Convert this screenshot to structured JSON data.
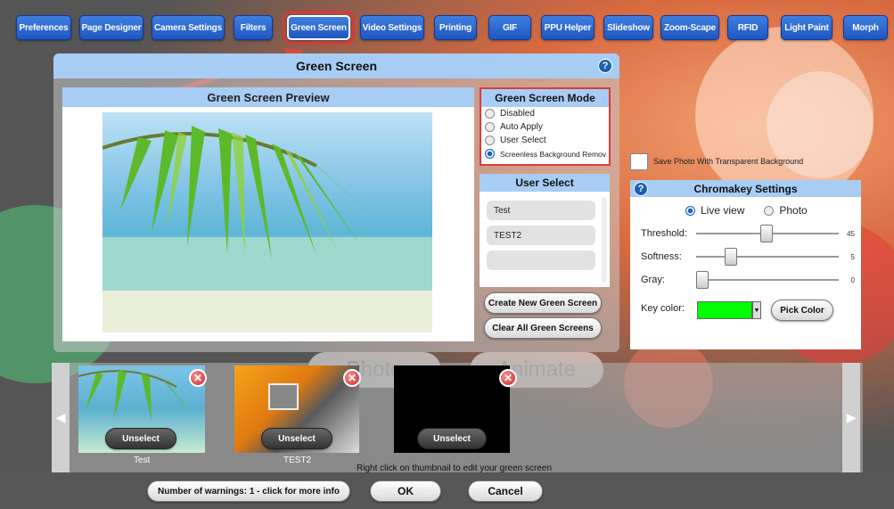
{
  "tabs": [
    "Preferences",
    "Page Designer",
    "Camera Settings",
    "Filters",
    "Green Screen",
    "Video Settings",
    "Printing",
    "GIF",
    "PPU Helper",
    "Slideshow",
    "Zoom-Scape",
    "RFID",
    "Light Paint",
    "Morph"
  ],
  "panel": {
    "title": "Green Screen",
    "help": "?"
  },
  "preview": {
    "title": "Green Screen Preview"
  },
  "mode": {
    "title": "Green Screen Mode",
    "options": [
      "Disabled",
      "Auto Apply",
      "User Select",
      "Screenless Background Remov"
    ],
    "selected": "Screenless Background Remov"
  },
  "user_select": {
    "title": "User Select",
    "items": [
      "Test",
      "TEST2",
      ""
    ]
  },
  "buttons": {
    "create": "Create New Green Screen",
    "clear": "Clear All Green Screens",
    "pick_color": "Pick Color",
    "warnings": "Number of warnings: 1 - click for more info",
    "ok": "OK",
    "cancel": "Cancel"
  },
  "save_transparent": "Save Photo With Transparent Background",
  "chroma": {
    "title": "Chromakey Settings",
    "live_view": "Live view",
    "photo": "Photo",
    "threshold_label": "Threshold:",
    "threshold_value": "45",
    "softness_label": "Softness:",
    "softness_value": "5",
    "gray_label": "Gray:",
    "gray_value": "0",
    "key_color_label": "Key color:",
    "key_color": "#00ff00"
  },
  "ghost": {
    "photo": "Photo",
    "animate": "Animate"
  },
  "thumbs": [
    {
      "label": "Test",
      "unselect": "Unselect"
    },
    {
      "label": "TEST2",
      "unselect": "Unselect"
    },
    {
      "label": "",
      "unselect": "Unselect"
    }
  ],
  "hint": "Right click on thumbnail to edit your green screen",
  "colors": {
    "accent": "#1f56c0",
    "header": "#a8cdf5",
    "highlight": "#d63c3c"
  }
}
